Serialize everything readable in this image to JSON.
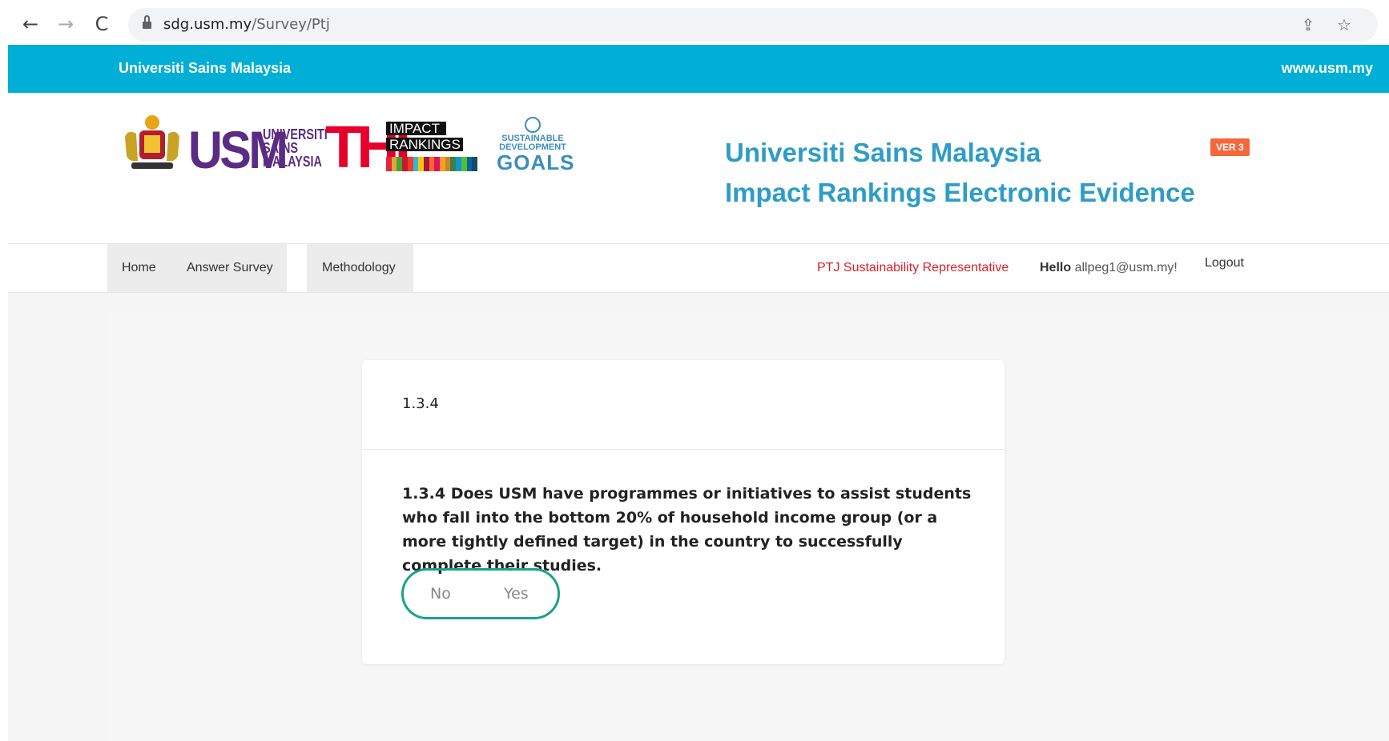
{
  "browser": {
    "url_host": "sdg.usm.my",
    "url_path": "/Survey/Ptj",
    "back_icon": "←",
    "forward_icon": "→",
    "reload_icon": "C",
    "share_icon": "⇪",
    "star_icon": "☆"
  },
  "topbar": {
    "left_text": "Universiti Sains Malaysia",
    "right_text": "www.usm.my",
    "color": "#00aed6"
  },
  "header": {
    "usm_letters": "USM",
    "usm_sub_lines": [
      "UNIVERSITI",
      "SAINS",
      "MALAYSIA"
    ],
    "the_letters": "THE",
    "impact_line1": "IMPACT",
    "impact_line2": "RANKINGS",
    "goals_small1": "SUSTAINABLE",
    "goals_small2": "DEVELOPMENT",
    "goals_big": "GOALS",
    "title_line1": "Universiti Sains Malaysia",
    "title_line2": "Impact Rankings Electronic Evidence",
    "version_badge": "VER 3",
    "title_color": "#2e9cc7"
  },
  "nav": {
    "home": "Home",
    "answer_survey": "Answer Survey",
    "methodology": "Methodology",
    "role": "PTJ Sustainability Representative",
    "hello_label": "Hello",
    "hello_user": "allpeg1@usm.my!",
    "logout": "Logout"
  },
  "card": {
    "title": "1.3.4",
    "question": "1.3.4 Does USM have programmes or initiatives to assist students who fall into the bottom 20% of household income group (or a more tightly defined target) in the country to successfully complete their studies.",
    "option_no": "No",
    "option_yes": "Yes",
    "accent": "#1aa38a"
  }
}
